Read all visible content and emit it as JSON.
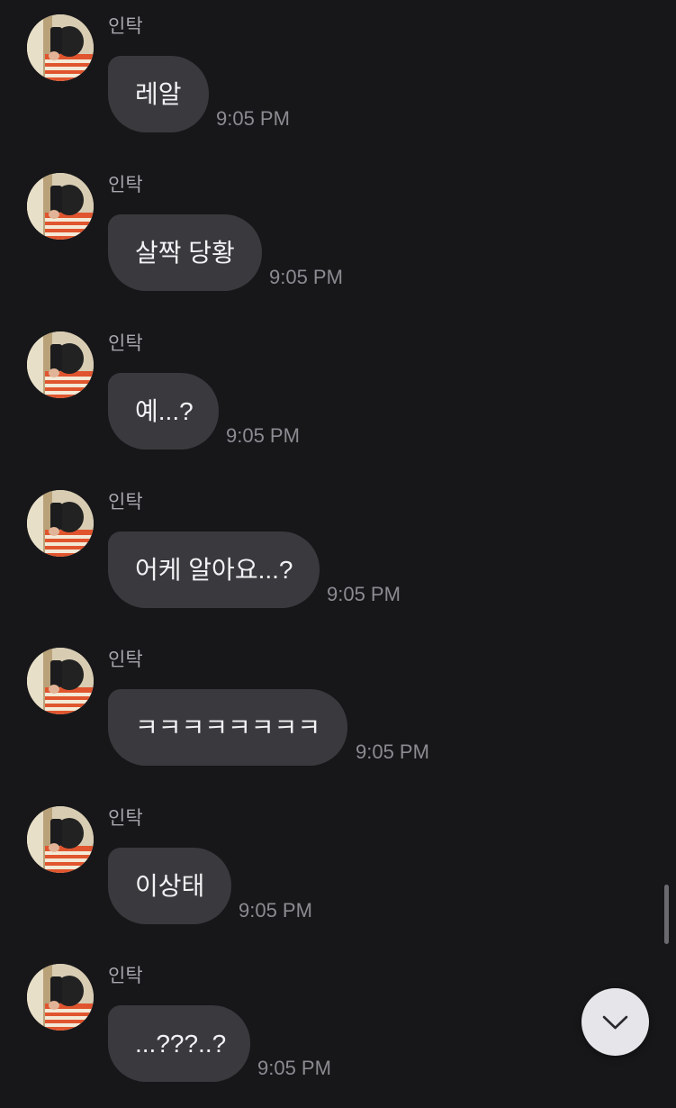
{
  "messages": [
    {
      "sender": "인탁",
      "text": "레알",
      "time": "9:05 PM"
    },
    {
      "sender": "인탁",
      "text": "살짝 당황",
      "time": "9:05 PM"
    },
    {
      "sender": "인탁",
      "text": "예...?",
      "time": "9:05 PM"
    },
    {
      "sender": "인탁",
      "text": "어케 알아요...?",
      "time": "9:05 PM"
    },
    {
      "sender": "인탁",
      "text": "ㅋㅋㅋㅋㅋㅋㅋㅋ",
      "time": "9:05 PM"
    },
    {
      "sender": "인탁",
      "text": "이상태",
      "time": "9:05 PM"
    },
    {
      "sender": "인탁",
      "text": "...???..?",
      "time": "9:05 PM"
    }
  ],
  "icons": {
    "avatar": "profile-photo",
    "scroll_down": "chevron-down-icon"
  },
  "colors": {
    "background": "#17171a",
    "bubble": "#3a3a3e",
    "bubble_text": "#f2f2f4",
    "sender": "#a7a7ad",
    "timestamp": "#8b8b91",
    "scroll_button": "#e6e6ea"
  }
}
